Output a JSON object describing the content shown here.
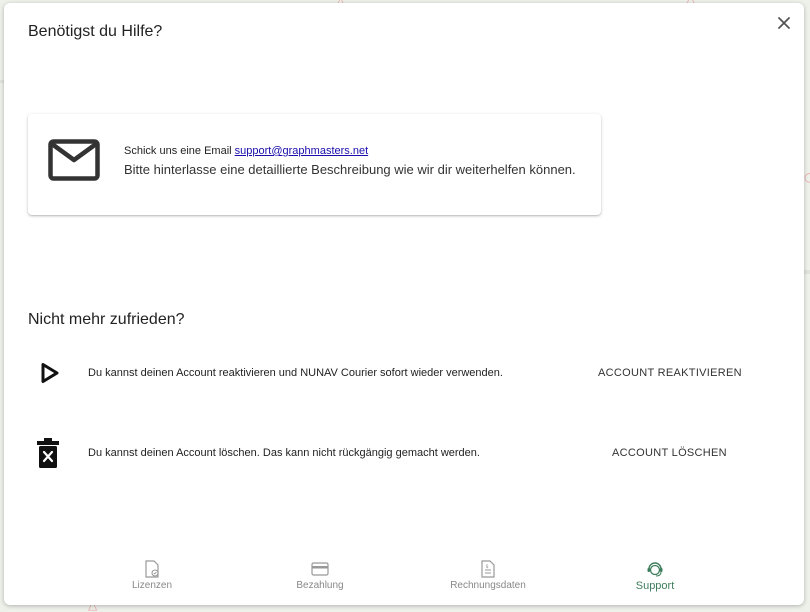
{
  "dialog": {
    "title": "Benötigst du Hilfe?"
  },
  "email_card": {
    "prompt": "Schick uns eine Email",
    "email": "support@graphmasters.net",
    "description": "Bitte hinterlasse eine detaillierte Beschreibung wie wir dir weiterhelfen können."
  },
  "unsatisfied": {
    "title": "Nicht mehr zufrieden?",
    "reactivate": {
      "text": "Du kannst deinen Account reaktivieren und NUNAV Courier sofort wieder verwenden.",
      "button": "ACCOUNT REAKTIVIEREN"
    },
    "delete": {
      "text": "Du kannst deinen Account löschen. Das kann nicht rückgängig gemacht werden.",
      "button": "ACCOUNT LÖSCHEN"
    }
  },
  "bottom_nav": {
    "items": [
      {
        "label": "Lizenzen",
        "icon": "license-icon",
        "active": false
      },
      {
        "label": "Bezahlung",
        "icon": "credit-card-icon",
        "active": false
      },
      {
        "label": "Rechnungsdaten",
        "icon": "invoice-icon",
        "active": false
      },
      {
        "label": "Support",
        "icon": "support-agent-icon",
        "active": true
      }
    ]
  },
  "colors": {
    "active_nav": "#3e7d5c",
    "link": "#1a0dab",
    "icon_dark": "#111111"
  }
}
